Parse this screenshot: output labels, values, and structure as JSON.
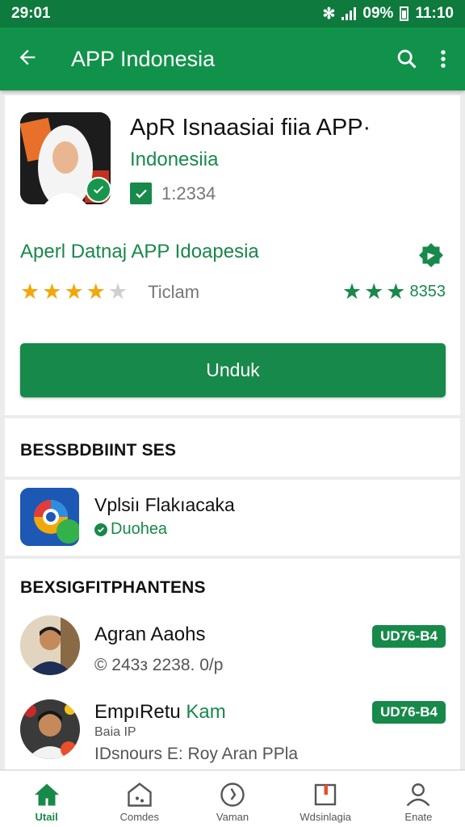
{
  "status": {
    "time": "29:01",
    "battery": "09%",
    "clock": "11:10"
  },
  "appbar": {
    "title": "APP Indonesia",
    "icons": [
      "back-arrow-icon",
      "search-icon",
      "more-vert-icon"
    ]
  },
  "app": {
    "name": "ApR Isnaasiai fiia APP·",
    "developer": "Indonesiia",
    "count": "1:2334",
    "subtitle": "Aperl Datnaj APP Idoapesia",
    "rating_stars": 4,
    "rating_label": "Ticlam",
    "green_stars": 3,
    "green_count": "8353",
    "install_label": "Unduk"
  },
  "section1": {
    "title": "BESSBDBIINT SES"
  },
  "related_app": {
    "name": "Vplsiı Flakıacaka",
    "tag": "Duohea"
  },
  "section2": {
    "title": "BEXSIGFITPHANTENS"
  },
  "reviews": [
    {
      "name": "Agran Aaohs",
      "name_green": "",
      "sub": "",
      "meta": "© 243з 2238. 0/p",
      "badge": "UD76-B4"
    },
    {
      "name": "EmpıRetu",
      "name_green": "Kam",
      "sub": "Baia IP",
      "meta": "IDsnours E: Roy Aran PPla",
      "badge": "UD76-B4"
    }
  ],
  "bottom_nav": [
    {
      "label": "Utail",
      "icon": "home-icon",
      "active": true
    },
    {
      "label": "Comdes",
      "icon": "games-icon",
      "active": false
    },
    {
      "label": "Vaman",
      "icon": "compass-icon",
      "active": false
    },
    {
      "label": "Wdsinlagia",
      "icon": "books-icon",
      "active": false
    },
    {
      "label": "Enate",
      "icon": "account-icon",
      "active": false
    }
  ],
  "colors": {
    "statusbar": "#0e7a3d",
    "appbar": "#11924a",
    "accent": "#17894a",
    "star": "#f2a80c"
  }
}
